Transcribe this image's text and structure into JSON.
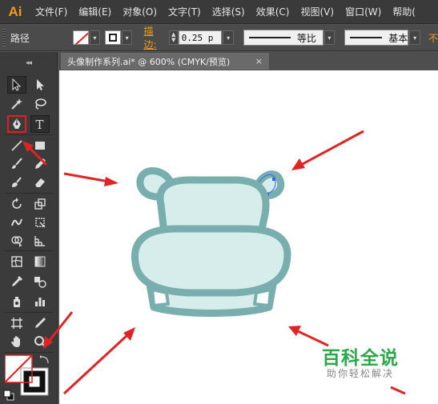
{
  "app": {
    "logo": "Ai",
    "accent": "#f29a1d"
  },
  "menu": [
    "文件(F)",
    "编辑(E)",
    "对象(O)",
    "文字(T)",
    "选择(S)",
    "效果(C)",
    "视图(V)",
    "窗口(W)",
    "帮助("
  ],
  "control": {
    "selection_label": "路径",
    "stroke_label": "描边:",
    "stroke_weight": "0.25 p",
    "profile_uniform": "等比",
    "brush_basic": "基本",
    "cut_text": "不"
  },
  "document": {
    "tab_title": "头像制作系列.ai* @ 600% (CMYK/预览)",
    "close_glyph": "×"
  },
  "toolbar": {
    "collapse_glyph": "◂◂",
    "tools": [
      "selection-tool",
      "direct-selection-tool",
      "magic-wand-tool",
      "lasso-tool",
      "pen-tool",
      "type-tool",
      "line-tool",
      "rectangle-tool",
      "paintbrush-tool",
      "pencil-tool",
      "blob-brush-tool",
      "eraser-tool",
      "rotate-tool",
      "scale-tool",
      "warp-tool",
      "free-transform-tool",
      "shape-builder-tool",
      "perspective-grid-tool",
      "mesh-tool",
      "gradient-tool",
      "eyedropper-tool",
      "blend-tool",
      "symbol-sprayer-tool",
      "column-graph-tool",
      "artboard-tool",
      "slice-tool",
      "hand-tool",
      "zoom-tool"
    ]
  },
  "artwork": {
    "fill": "#d7edec",
    "stroke": "#78afae",
    "arrow_color": "#e02424"
  },
  "watermark": {
    "title": "百科全说",
    "subtitle": "助你轻松解决",
    "color": "#2aa84a"
  }
}
